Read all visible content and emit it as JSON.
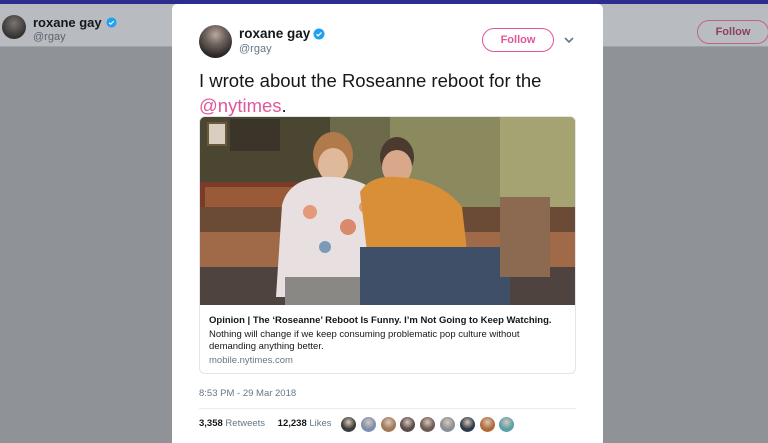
{
  "background": {
    "user_name": "roxane gay",
    "user_handle": "@rgay",
    "follow_label": "Follow"
  },
  "tweet": {
    "author_name": "roxane gay",
    "author_handle": "@rgay",
    "follow_label": "Follow",
    "more_icon": "chevron-down-icon",
    "text_before": "I wrote about the Roseanne reboot for the",
    "mention": "@nytimes",
    "text_after": ".",
    "card": {
      "title": "Opinion | The ‘Roseanne’ Reboot Is Funny. I’m Not Going to Keep Watching.",
      "description": "Nothing will change if we keep consuming problematic pop culture without demanding anything better.",
      "domain": "mobile.nytimes.com"
    },
    "timestamp": "8:53 PM - 29 Mar 2018",
    "retweets_count": "3,358",
    "retweets_label": "Retweets",
    "likes_count": "12,238",
    "likes_label": "Likes",
    "liker_colors": [
      "#3b3b3b",
      "#7a8fb0",
      "#a0785a",
      "#5a4a48",
      "#6b5a55",
      "#8a8f96",
      "#2f3b4a",
      "#b06a3a",
      "#5aa0a8"
    ]
  },
  "colors": {
    "accent": "#e0569b",
    "verified": "#1da1f2"
  }
}
